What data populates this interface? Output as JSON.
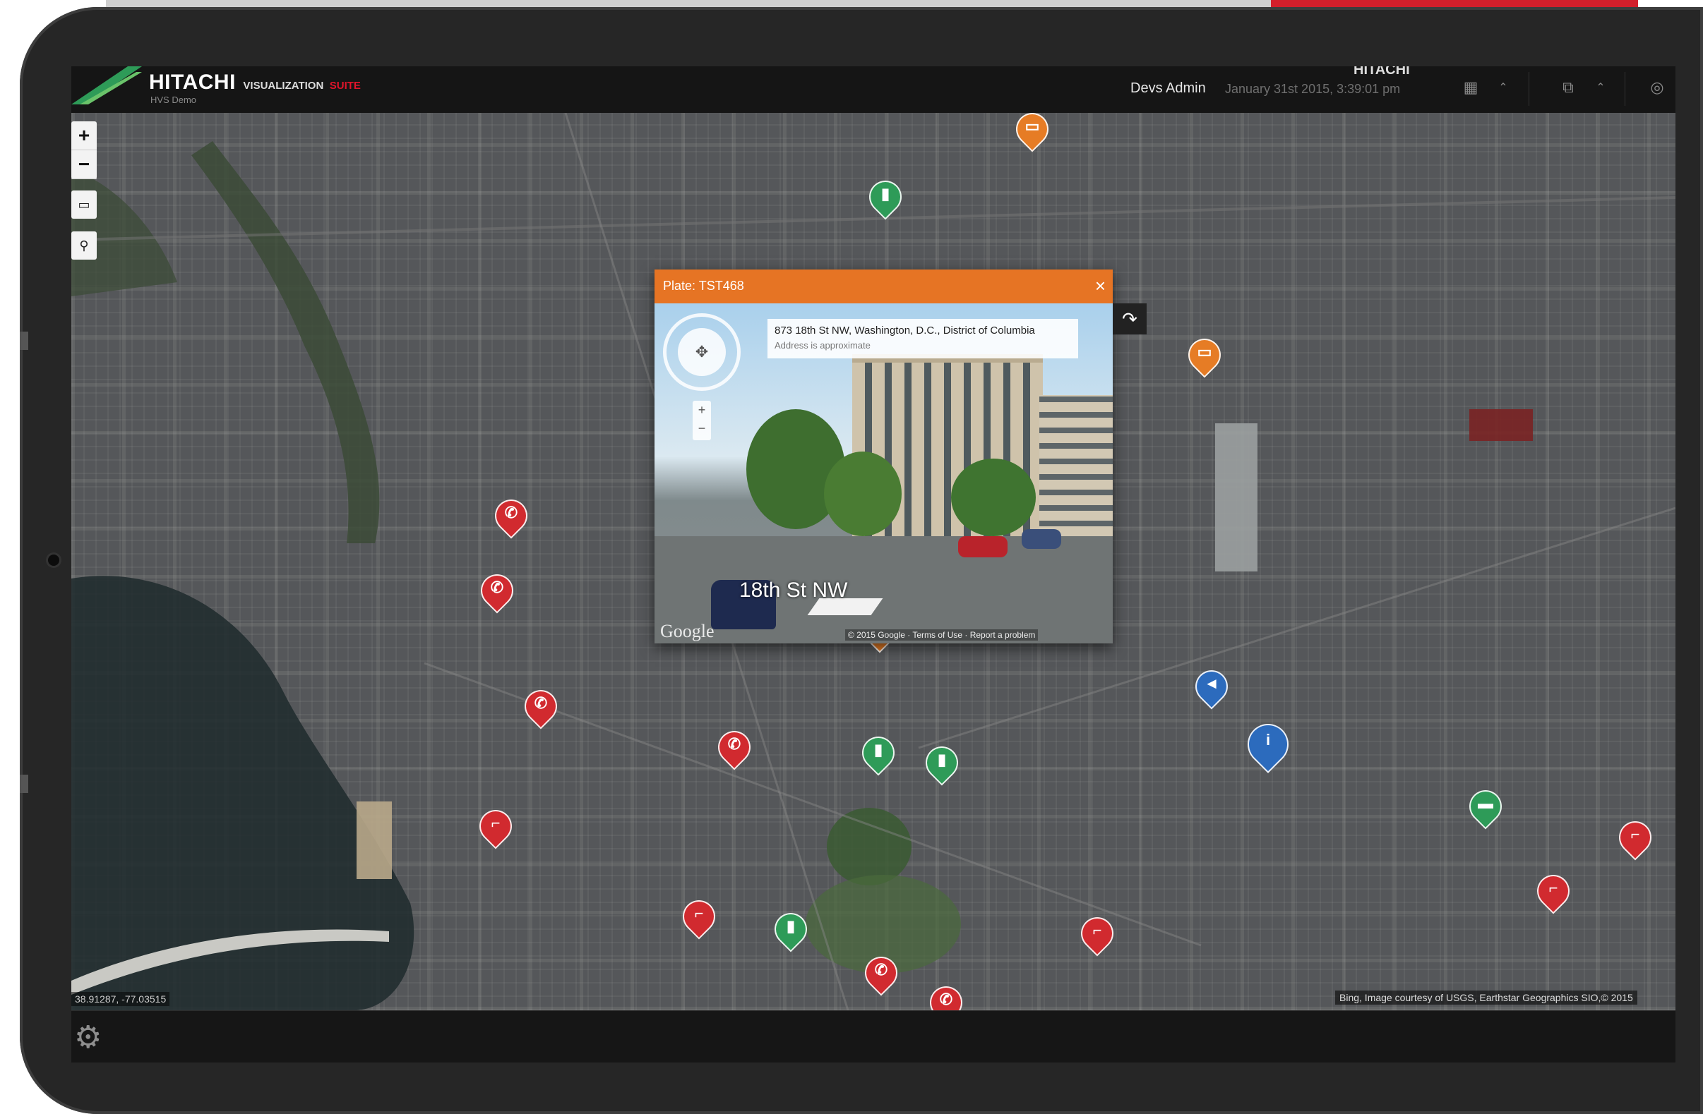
{
  "header": {
    "brand_name": "HITACHI",
    "brand_suite_part1": "VISUALIZATION",
    "brand_suite_part2": "SUITE",
    "brand_subtitle": "HVS Demo",
    "user_name": "Devs Admin",
    "datetime": "January 31st 2015, 3:39:01 pm",
    "corp_mark": "HITACHI",
    "grid_icon": "grid-view-icon",
    "chevron_icon": "chevron-up-icon",
    "window_icon": "window-layout-icon",
    "settings_icon": "settings-icon"
  },
  "map_controls": {
    "zoom_in": "+",
    "zoom_out": "−",
    "tool_icon": "legend-icon",
    "pin_icon": "location-pin-icon"
  },
  "popup": {
    "title": "Plate: TST468",
    "close": "×",
    "address": "873 18th St NW, Washington, D.C., District of Columbia",
    "address_note": "Address is approximate",
    "street_label": "18th St NW",
    "watermark": "Google",
    "copyright": "© 2015 Google · Terms of Use · Report a problem"
  },
  "markers": [
    {
      "color": "orange",
      "icon": "bus-icon"
    },
    {
      "color": "green",
      "icon": "trash-icon"
    },
    {
      "color": "orange",
      "icon": "bus-icon"
    },
    {
      "color": "red",
      "icon": "phone-icon"
    },
    {
      "color": "red",
      "icon": "phone-icon"
    },
    {
      "color": "orange",
      "icon": "bus-icon"
    },
    {
      "color": "red",
      "icon": "phone-icon"
    },
    {
      "color": "blue",
      "icon": "megaphone-icon"
    },
    {
      "color": "blue",
      "icon": "info-icon"
    },
    {
      "color": "red",
      "icon": "phone-icon"
    },
    {
      "color": "green",
      "icon": "trash-icon"
    },
    {
      "color": "green",
      "icon": "trash-icon"
    },
    {
      "color": "red",
      "icon": "gun-icon"
    },
    {
      "color": "green",
      "icon": "car-icon"
    },
    {
      "color": "red",
      "icon": "gun-icon"
    },
    {
      "color": "red",
      "icon": "gun-icon"
    },
    {
      "color": "red",
      "icon": "gun-icon"
    },
    {
      "color": "green",
      "icon": "trash-icon"
    },
    {
      "color": "red",
      "icon": "gun-icon"
    },
    {
      "color": "red",
      "icon": "phone-icon"
    },
    {
      "color": "red",
      "icon": "phone-icon"
    }
  ],
  "status": {
    "coordinates": "38.91287, -77.03515",
    "attribution": "Bing, Image courtesy of USGS, Earthstar Geographics SIO,© 2015"
  },
  "colors": {
    "accent_orange": "#e67424",
    "brand_red": "#e0142a",
    "marker_red": "#d12a2f",
    "marker_green": "#2e9b58",
    "marker_blue": "#2c6bbd"
  }
}
